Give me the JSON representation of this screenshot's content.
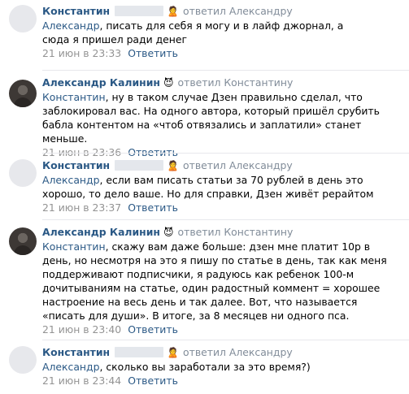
{
  "comments": [
    {
      "author": "Константин",
      "author_emoji": "🙎",
      "replied": "ответил Александру",
      "mention": "Александр",
      "text": ", писать для себя я могу и в лайф джорнал, а сюда я пришел ради денег",
      "date": "21 июн в 23:33",
      "reply_label": "Ответить"
    },
    {
      "author": "Александр Калинин",
      "author_emoji": "😈",
      "replied": "ответил Константину",
      "mention": "Константин",
      "text": ", ну в таком случае Дзен правильно сделал, что заблокировал вас. На одного автора, который пришёл срубить бабла контентом на «чтоб отвязались и заплатили» станет меньше.",
      "date": "21 июн в 23:36",
      "reply_label": "Ответить"
    },
    {
      "author": "Константин",
      "author_emoji": "🙎",
      "replied": "ответил Александру",
      "mention": "Александр",
      "text": ", если вам писать статьи за 70 рублей в день это хорошо, то дело ваше. Но для справки, Дзен живёт рерайтом",
      "date": "21 июн в 23:37",
      "reply_label": "Ответить"
    },
    {
      "author": "Александр Калинин",
      "author_emoji": "😈",
      "replied": "ответил Константину",
      "mention": "Константин",
      "text": ", скажу вам даже больше: дзен мне платит 10р в день, но несмотря на это я пишу по статье в день, так как меня поддерживают подписчики, я радуюсь как ребенок 100-м дочитываниям на статье, один радостный коммент = хорошее настроение на весь день и так далее. Вот, что называется «писать для души». В итоге, за 8 месяцев ни одного пса.",
      "date": "21 июн в 23:40",
      "reply_label": "Ответить"
    },
    {
      "author": "Константин",
      "author_emoji": "🙎",
      "replied": "ответил Александру",
      "mention": "Александр",
      "text": ", сколько вы заработали за это время?)",
      "date": "21 июн в 23:44",
      "reply_label": "Ответить"
    }
  ]
}
